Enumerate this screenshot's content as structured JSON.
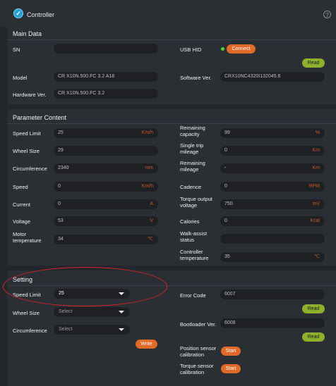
{
  "app": {
    "title": "Controller",
    "help_glyph": "?"
  },
  "main_data": {
    "title": "Main Data",
    "sn_label": "SN",
    "sn_value": "",
    "usb_label": "USB HID",
    "connect_label": "Connect",
    "read_label": "Read",
    "model_label": "Model",
    "model_value": "CR X10N.500.FC 3.2 A18",
    "software_label": "Software Ver.",
    "software_value": "CRX10NC4320I132045.6",
    "hardware_label": "Hardware Ver.",
    "hardware_value": "CR X10N.500.FC 3.2"
  },
  "params": {
    "title": "Parameter Content",
    "left": [
      {
        "label": "Speed Limit",
        "value": "25",
        "unit": "Km/h"
      },
      {
        "label": "Wheel Size",
        "value": "29",
        "unit": ""
      },
      {
        "label": "Circumference",
        "value": "2340",
        "unit": "mm"
      },
      {
        "label": "Speed",
        "value": "0",
        "unit": "Km/h"
      },
      {
        "label": "Current",
        "value": "0",
        "unit": "A"
      },
      {
        "label": "Voltage",
        "value": "53",
        "unit": "V"
      },
      {
        "label": "Motor temperature",
        "value": "34",
        "unit": "℃"
      }
    ],
    "right": [
      {
        "label": "Remaining capacity",
        "value": "99",
        "unit": "%"
      },
      {
        "label": "Single trip mileage",
        "value": "0",
        "unit": "Km"
      },
      {
        "label": "Remaining mileage",
        "value": "-",
        "unit": "Km"
      },
      {
        "label": "Cadence",
        "value": "0",
        "unit": "RPM"
      },
      {
        "label": "Torque output voltage",
        "value": "750",
        "unit": "mV"
      },
      {
        "label": "Calories",
        "value": "0",
        "unit": "Kcal"
      },
      {
        "label": "Walk-assist status",
        "value": "",
        "unit": ""
      },
      {
        "label": "Controller temperature",
        "value": "35",
        "unit": "℃"
      }
    ]
  },
  "setting": {
    "title": "Setting",
    "speed_limit_label": "Speed Limit",
    "speed_limit_value": "25",
    "wheel_size_label": "Wheel Size",
    "wheel_size_value": "Select",
    "circumference_label": "Circumference",
    "circumference_value": "Select",
    "write_label": "Write",
    "error_code_label": "Error Code",
    "error_code_value": "6007",
    "read_label": "Read",
    "bootloader_label": "Bootloader Ver.",
    "bootloader_value": "6008",
    "read2_label": "Read",
    "position_label": "Position sensor calibration",
    "position_btn": "Start",
    "torque_label": "Torque sensor calibration",
    "torque_btn": "Start"
  },
  "colors": {
    "accent_orange": "#e06a28",
    "accent_green": "#8db02d",
    "unit_orange": "#c8572b",
    "annotation_red": "#d8252a"
  }
}
